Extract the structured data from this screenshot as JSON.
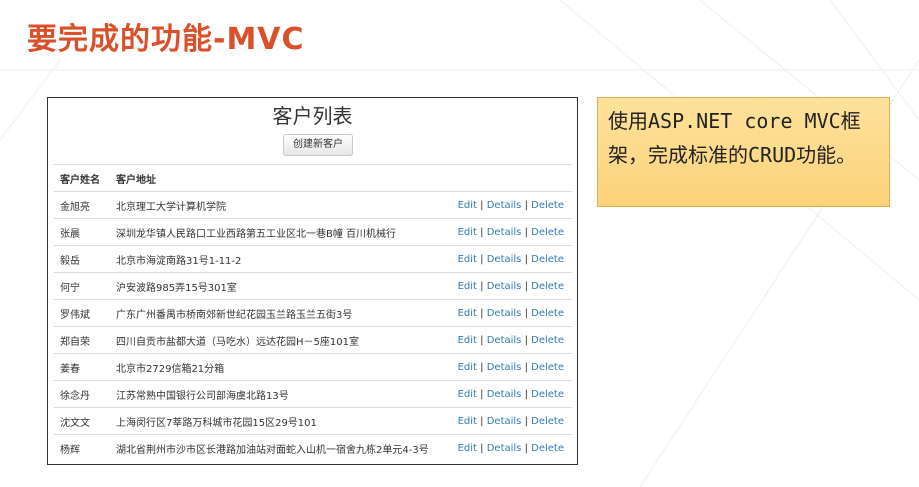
{
  "slide": {
    "title": "要完成的功能-MVC",
    "note": "使用ASP.NET core MVC框架，完成标准的CRUD功能。"
  },
  "colors": {
    "title": "#d9502a",
    "link": "#337ab7",
    "note_bg": "#fcd27a"
  },
  "app": {
    "title": "客户列表",
    "create_button": "创建新客户",
    "headers": {
      "name": "客户姓名",
      "address": "客户地址"
    },
    "actions": {
      "edit": "Edit",
      "details": "Details",
      "delete": "Delete",
      "separator": "|"
    },
    "rows": [
      {
        "name": "金旭亮",
        "address": "北京理工大学计算机学院"
      },
      {
        "name": "张晨",
        "address": "深圳龙华镇人民路口工业西路第五工业区北一巷B幢 百川机械行"
      },
      {
        "name": "毅岳",
        "address": "北京市海淀南路31号1-11-2"
      },
      {
        "name": "何宁",
        "address": "沪安波路985弄15号301室"
      },
      {
        "name": "罗伟斌",
        "address": "广东广州番禺市桥南郊新世纪花园玉兰路玉兰五街3号"
      },
      {
        "name": "郑自荣",
        "address": "四川自贡市盐都大道（马吃水）远达花园H－5座101室"
      },
      {
        "name": "姜春",
        "address": "北京市2729信箱21分箱"
      },
      {
        "name": "徐念丹",
        "address": "江苏常熟中国银行公司部海虞北路13号"
      },
      {
        "name": "沈文文",
        "address": "上海闵行区7莘路万科城市花园15区29号101"
      },
      {
        "name": "杨辉",
        "address": "湖北省荆州市沙市区长港路加油站对面蛇入山机一宿舍九栋2单元4-3号"
      }
    ]
  }
}
